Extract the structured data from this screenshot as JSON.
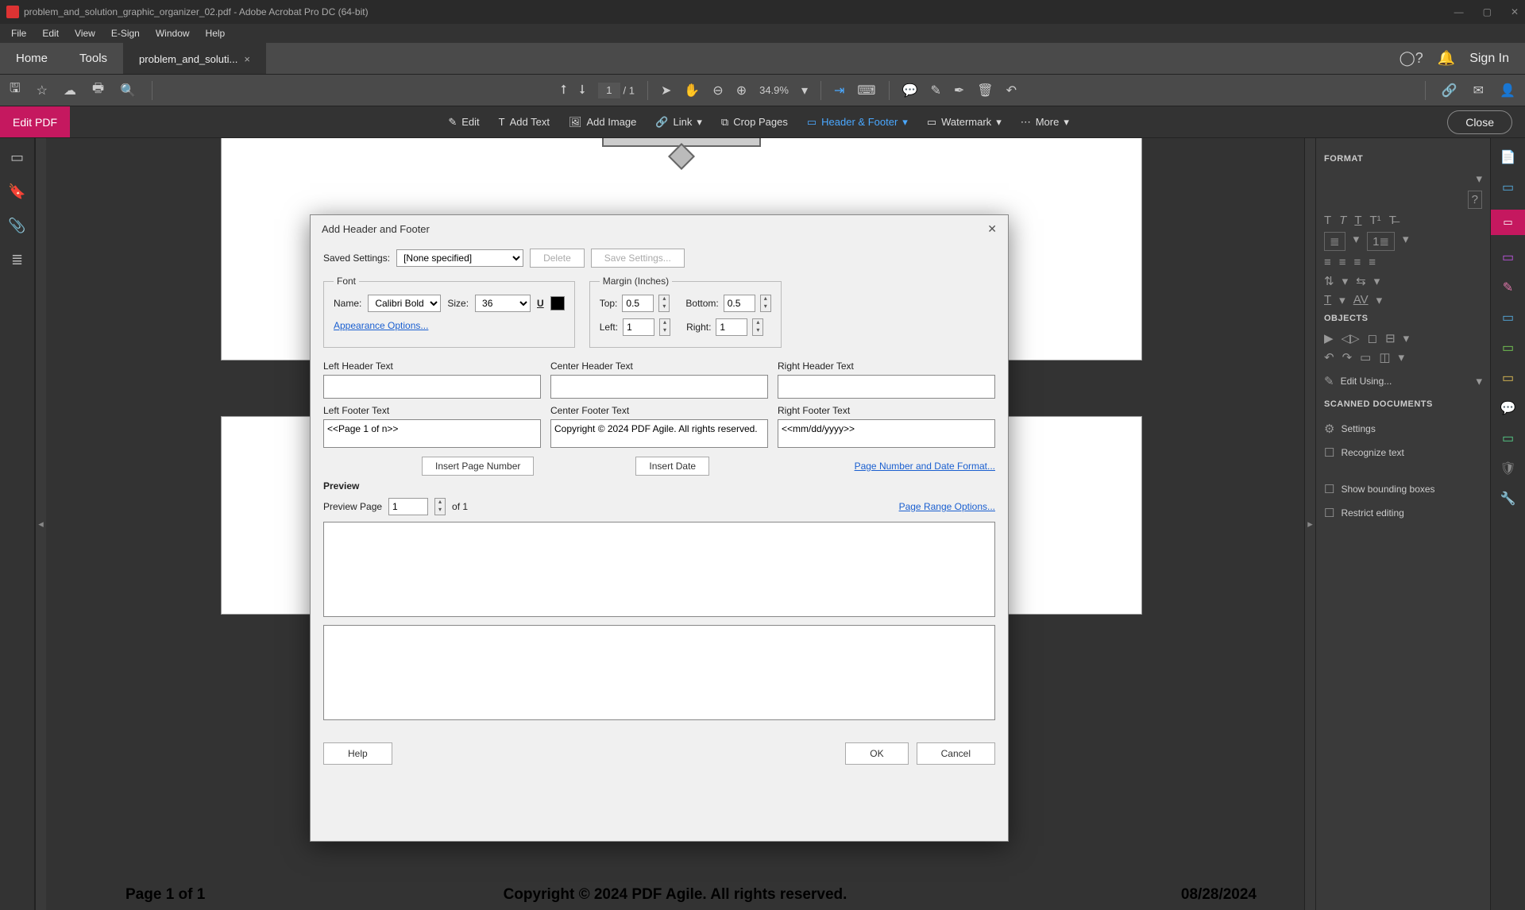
{
  "title": "problem_and_solution_graphic_organizer_02.pdf - Adobe Acrobat Pro DC (64-bit)",
  "menu": [
    "File",
    "Edit",
    "View",
    "E-Sign",
    "Window",
    "Help"
  ],
  "tabs": {
    "home": "Home",
    "tools": "Tools",
    "doc": "problem_and_soluti...",
    "signin": "Sign In"
  },
  "toolbar": {
    "page_cur": "1",
    "page_sep": "/",
    "page_total": "1",
    "zoom": "34.9%"
  },
  "editbar": {
    "label": "Edit PDF",
    "edit": "Edit",
    "addtext": "Add Text",
    "addimg": "Add Image",
    "link": "Link",
    "crop": "Crop Pages",
    "hf": "Header & Footer",
    "wm": "Watermark",
    "more": "More",
    "close": "Close"
  },
  "rpanel": {
    "format": "FORMAT",
    "objects": "OBJECTS",
    "editusing": "Edit Using...",
    "scanned": "SCANNED DOCUMENTS",
    "settings": "Settings",
    "recog": "Recognize text",
    "showbb": "Show bounding boxes",
    "restrict": "Restrict editing"
  },
  "page_preview": {
    "footL": "Page 1 of 1",
    "footC": "Copyright © 2024 PDF Agile. All rights reserved.",
    "footR": "08/28/2024"
  },
  "dlg": {
    "title": "Add Header and Footer",
    "saved_lbl": "Saved Settings:",
    "saved_val": "[None specified]",
    "delete": "Delete",
    "save": "Save Settings...",
    "font_legend": "Font",
    "name_lbl": "Name:",
    "name_val": "Calibri Bold",
    "size_lbl": "Size:",
    "size_val": "36",
    "appearance": "Appearance Options...",
    "margin_legend": "Margin (Inches)",
    "top": "Top:",
    "top_v": "0.5",
    "bottom": "Bottom:",
    "bottom_v": "0.5",
    "left": "Left:",
    "left_v": "1",
    "right": "Right:",
    "right_v": "1",
    "lh": "Left Header Text",
    "ch": "Center Header Text",
    "rh": "Right Header Text",
    "lf": "Left Footer Text",
    "cf": "Center Footer Text",
    "rf": "Right Footer Text",
    "lf_v": "<<Page 1 of n>>",
    "cf_v": "Copyright © 2024 PDF Agile. All rights reserved.",
    "rf_v": "<<mm/dd/yyyy>>",
    "ins_page": "Insert Page Number",
    "ins_date": "Insert Date",
    "pnf": "Page Number and Date Format...",
    "preview": "Preview",
    "pp_lbl": "Preview Page",
    "pp_v": "1",
    "pp_of": "of 1",
    "pro": "Page Range Options...",
    "help": "Help",
    "ok": "OK",
    "cancel": "Cancel"
  }
}
